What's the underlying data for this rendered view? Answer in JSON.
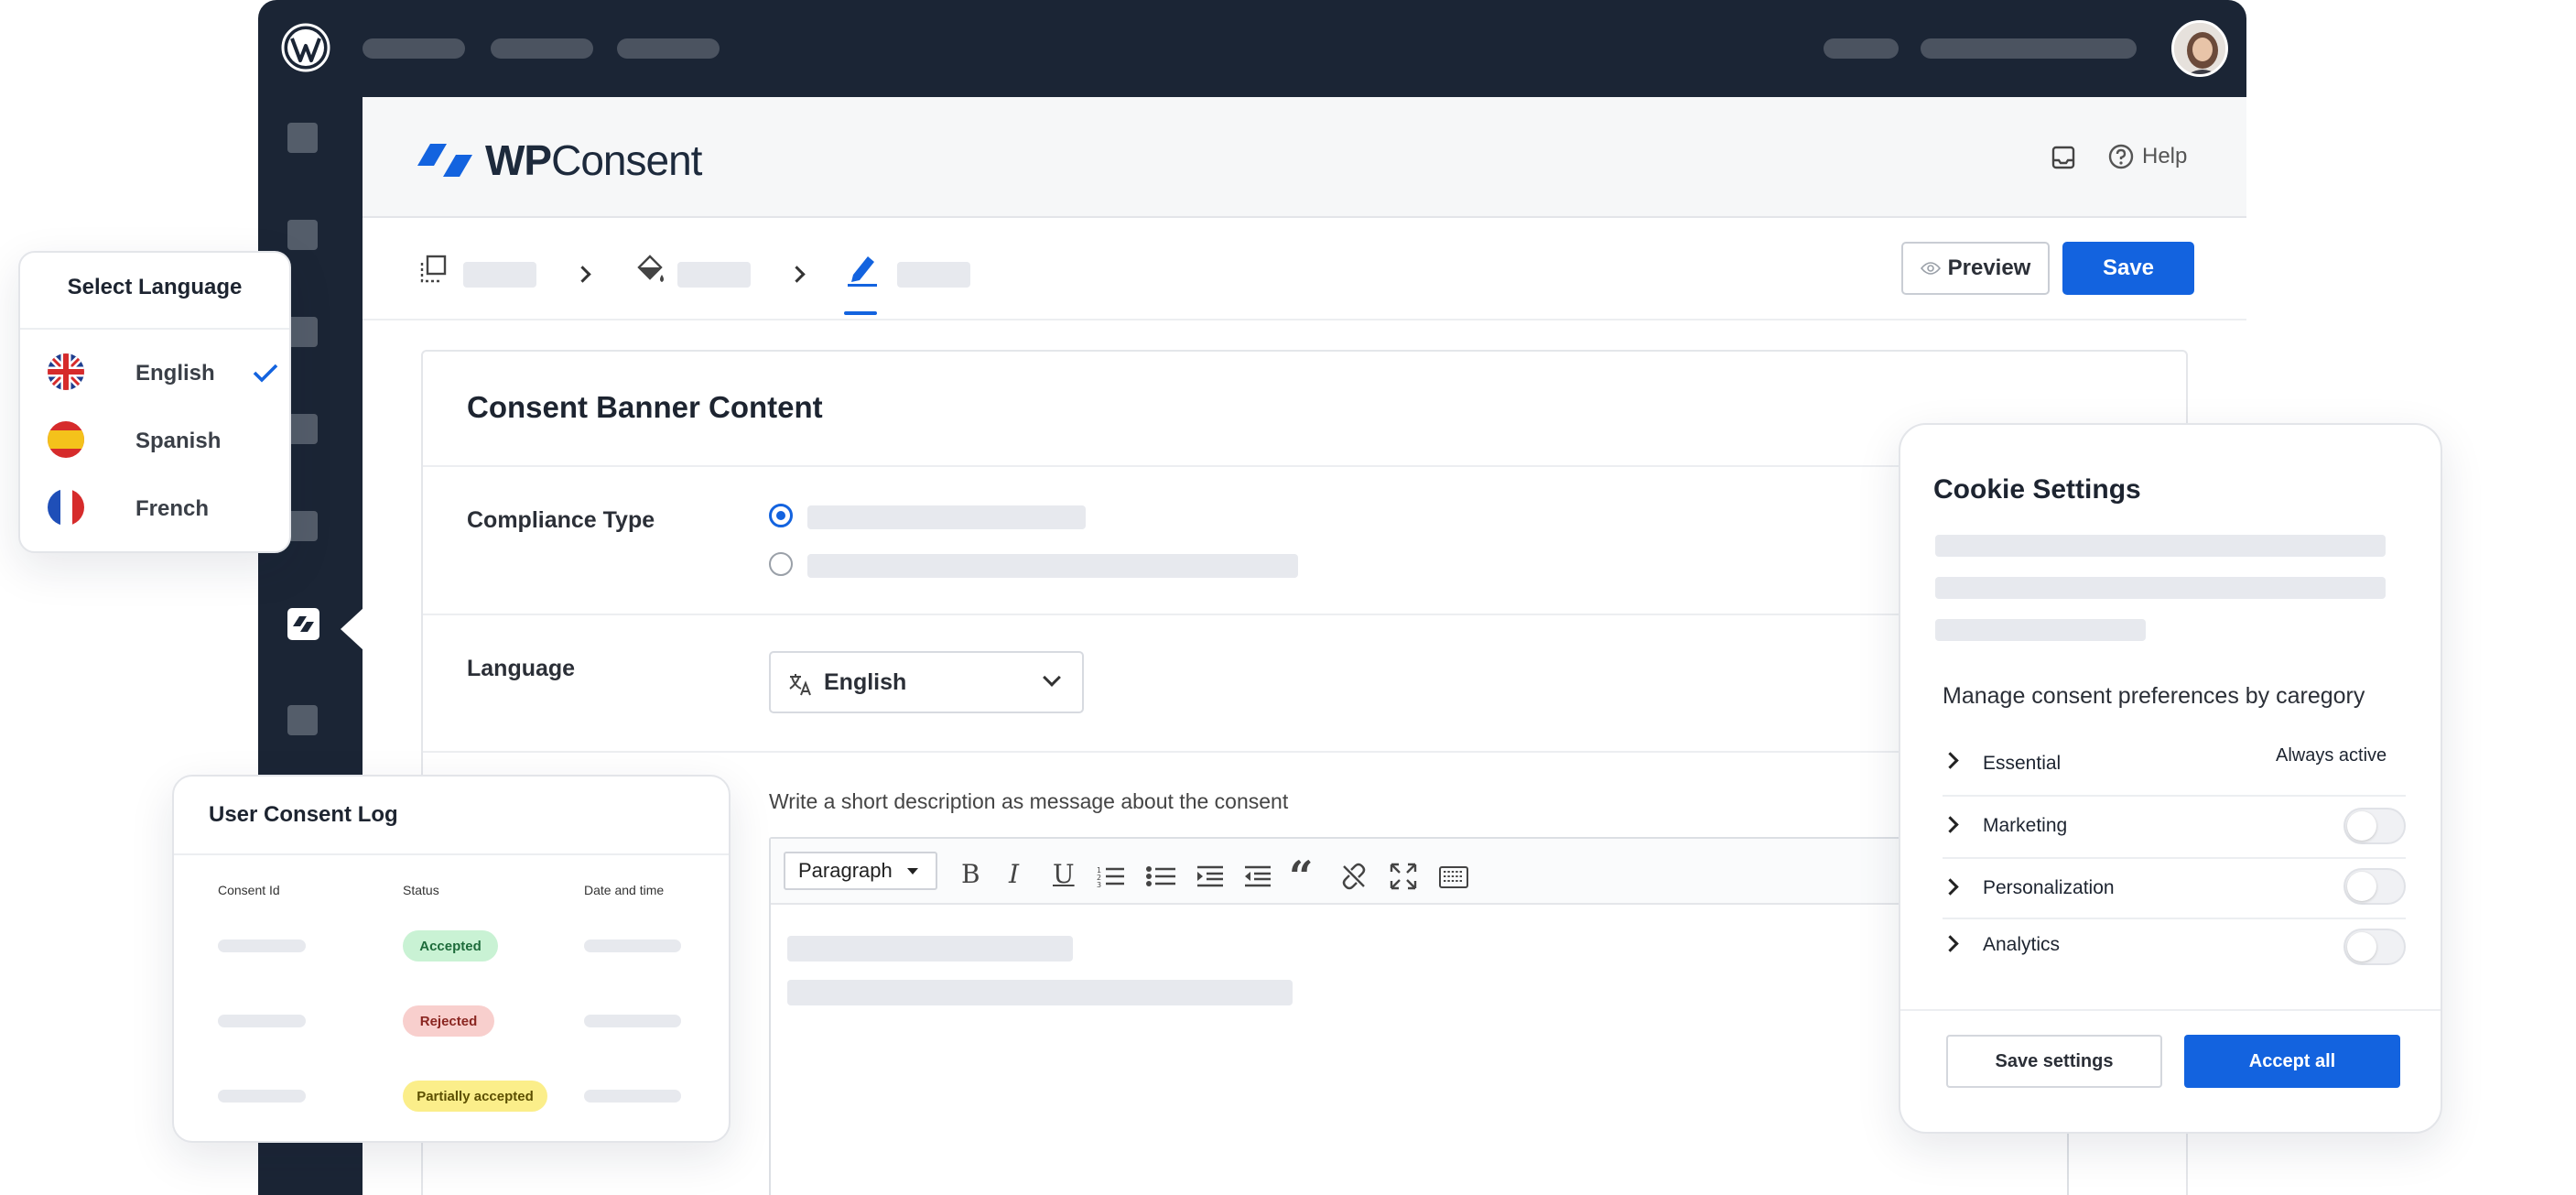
{
  "brand": {
    "name_bold": "WP",
    "name_rest": "Consent",
    "accent": "#1363df"
  },
  "header": {
    "help_label": "Help"
  },
  "toolbar": {
    "preview_label": "Preview",
    "save_label": "Save"
  },
  "card": {
    "title": "Consent Banner Content",
    "compliance_label": "Compliance Type",
    "language_label": "Language",
    "language_value": "English",
    "message_hint": "Write a short description as message about the consent",
    "format_select": "Paragraph"
  },
  "language_popup": {
    "title": "Select Language",
    "options": [
      {
        "label": "English",
        "selected": true
      },
      {
        "label": "Spanish",
        "selected": false
      },
      {
        "label": "French",
        "selected": false
      }
    ]
  },
  "consent_log": {
    "title": "User Consent Log",
    "columns": [
      "Consent Id",
      "Status",
      "Date and time"
    ],
    "rows": [
      {
        "status": "Accepted",
        "color": "#c9f2d4"
      },
      {
        "status": "Rejected",
        "color": "#f8cfcd"
      },
      {
        "status": "Partially accepted",
        "color": "#fbee8a"
      }
    ]
  },
  "cookie_settings": {
    "title": "Cookie Settings",
    "subtitle": "Manage consent preferences by caregory",
    "categories": [
      {
        "label": "Essential",
        "state": "Always active"
      },
      {
        "label": "Marketing",
        "enabled": false
      },
      {
        "label": "Personalization",
        "enabled": false
      },
      {
        "label": "Analytics",
        "enabled": false
      }
    ],
    "save_label": "Save settings",
    "accept_label": "Accept all"
  }
}
